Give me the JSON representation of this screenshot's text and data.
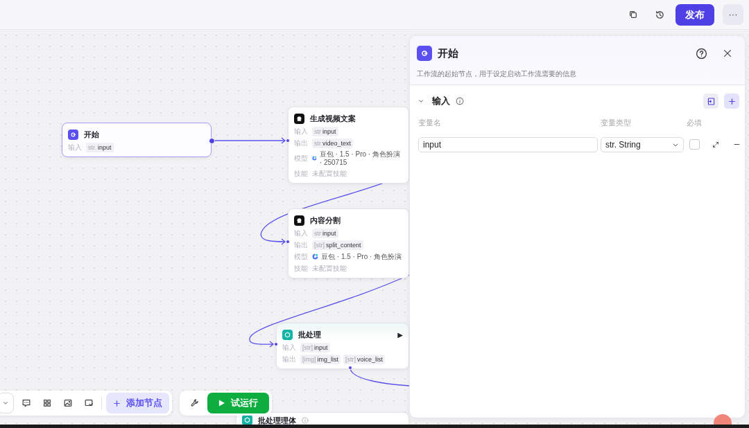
{
  "topbar": {
    "publish": "发布",
    "more": "···"
  },
  "nodes": [
    {
      "kind": "start",
      "title": "开始",
      "selected": true,
      "rows": [
        {
          "kind": "vars",
          "label": "输入",
          "tags": [
            {
              "type": "str.",
              "name": "input"
            }
          ]
        }
      ]
    },
    {
      "kind": "llm",
      "title": "生成视频文案",
      "selected": false,
      "rows": [
        {
          "kind": "vars",
          "label": "输入",
          "tags": [
            {
              "type": "str",
              "name": "input"
            }
          ]
        },
        {
          "kind": "vars",
          "label": "输出",
          "tags": [
            {
              "type": "str",
              "name": "video_text"
            }
          ]
        },
        {
          "kind": "model",
          "label": "模型",
          "text": "豆包 · 1.5 · Pro · 角色扮演 · 250715"
        },
        {
          "kind": "text",
          "label": "技能",
          "text": "未配置技能"
        }
      ]
    },
    {
      "kind": "llm",
      "title": "内容分割",
      "selected": false,
      "rows": [
        {
          "kind": "vars",
          "label": "输入",
          "tags": [
            {
              "type": "str",
              "name": "input"
            }
          ]
        },
        {
          "kind": "vars",
          "label": "输出",
          "tags": [
            {
              "type": "[str]",
              "name": "split_content"
            }
          ]
        },
        {
          "kind": "model",
          "label": "模型",
          "text": "豆包 · 1.5 · Pro · 角色扮演"
        },
        {
          "kind": "text",
          "label": "技能",
          "text": "未配置技能"
        }
      ]
    },
    {
      "kind": "batch",
      "title": "批处理",
      "selected": false,
      "run": "▶",
      "rows": [
        {
          "kind": "vars",
          "label": "输入",
          "tags": [
            {
              "type": "[str]",
              "name": "input"
            }
          ]
        },
        {
          "kind": "vars",
          "label": "输出",
          "tags": [
            {
              "type": "[img]",
              "name": "img_list"
            },
            {
              "type": "[str]",
              "name": "voice_list"
            }
          ]
        }
      ]
    },
    {
      "kind": "body",
      "title": "批处理理体",
      "selected": false
    }
  ],
  "toolbar": {
    "add_node": "添加节点",
    "run": "试运行"
  },
  "panel": {
    "title": "开始",
    "description": "工作流的起始节点，用于设定启动工作流需要的信息",
    "section": {
      "title": "输入",
      "expanded": true,
      "columns": [
        "变量名",
        "变量类型",
        "必填"
      ],
      "rows": [
        {
          "name": "input",
          "type": "str. String",
          "required": false
        }
      ]
    }
  }
}
